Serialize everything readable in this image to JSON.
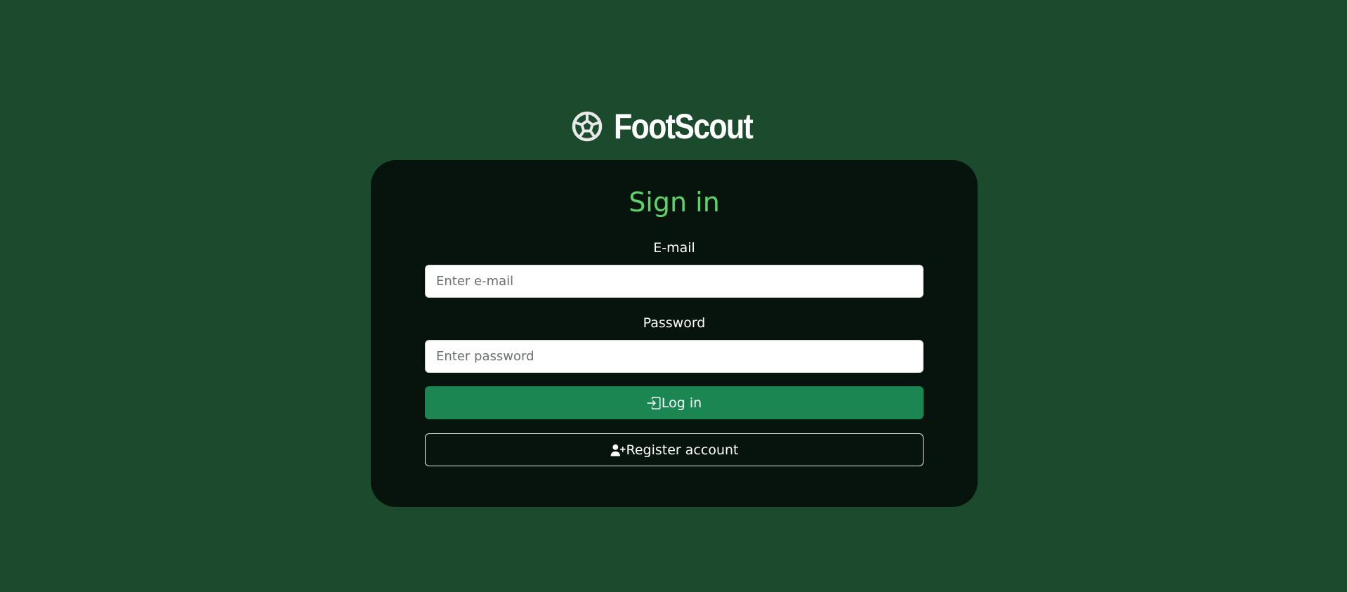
{
  "brand": {
    "name": "FootScout",
    "icon": "soccer-ball-icon"
  },
  "login": {
    "title": "Sign in",
    "email_label": "E-mail",
    "email_value": "",
    "email_placeholder": "Enter e-mail",
    "password_label": "Password",
    "password_value": "",
    "password_placeholder": "Enter password",
    "login_button": {
      "label": "Log in",
      "icon": "box-arrow-in-right-icon"
    },
    "register_button": {
      "label": "Register account",
      "icon": "person-plus-icon"
    }
  },
  "colors": {
    "page_background": "#1b4a2c",
    "card_background": "#07140d",
    "title": "#5cd46a",
    "primary_button": "#1a8753"
  }
}
